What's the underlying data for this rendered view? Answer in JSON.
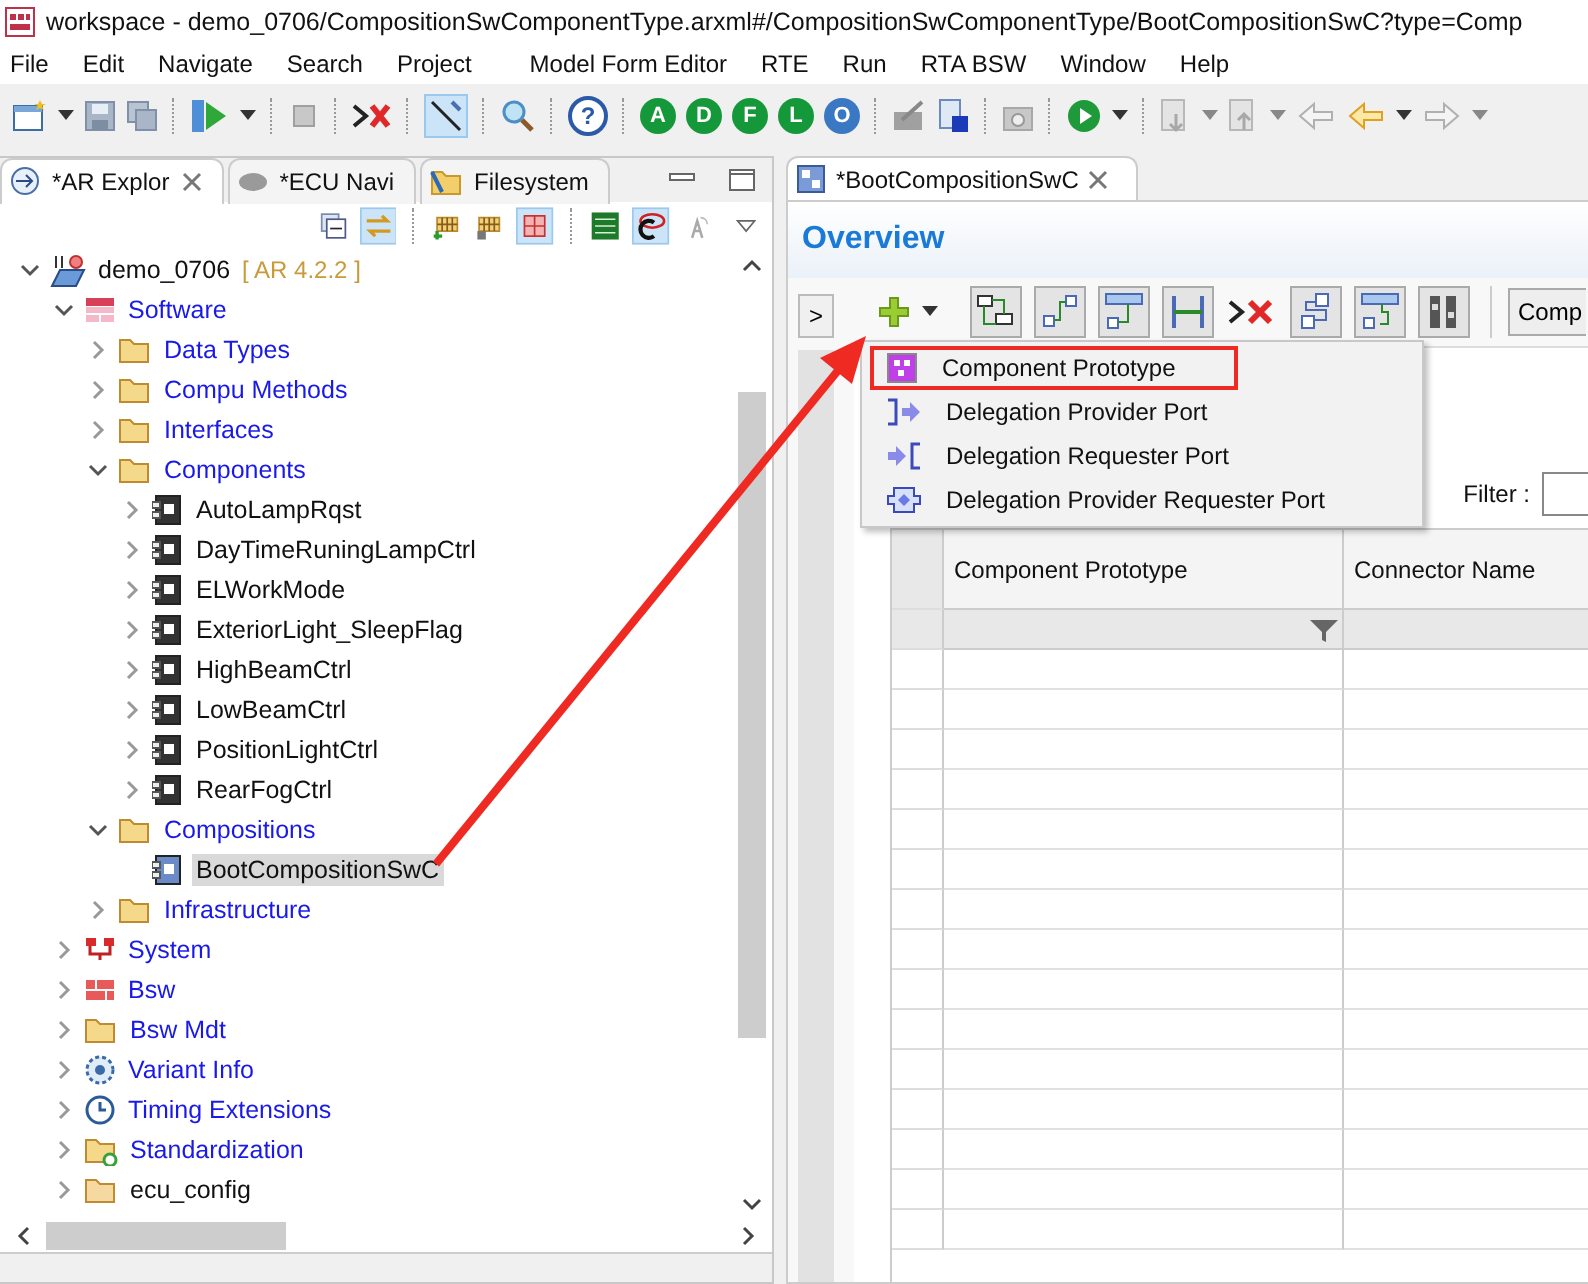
{
  "window": {
    "title": "workspace - demo_0706/CompositionSwComponentType.arxml#/CompositionSwComponentType/BootCompositionSwC?type=Comp"
  },
  "menu": [
    "File",
    "Edit",
    "Navigate",
    "Search",
    "Project",
    "Model Form Editor",
    "RTE",
    "Run",
    "RTA BSW",
    "Window",
    "Help"
  ],
  "toolbar": {
    "help": "?",
    "letter_buttons": [
      {
        "label": "A",
        "color": "#15983a"
      },
      {
        "label": "D",
        "color": "#15983a"
      },
      {
        "label": "F",
        "color": "#15983a"
      },
      {
        "label": "L",
        "color": "#15983a"
      },
      {
        "label": "O",
        "color": "#3b78c4"
      }
    ]
  },
  "left_panel": {
    "tabs": [
      {
        "label": "*AR Explor",
        "selected": true
      },
      {
        "label": "*ECU Navi",
        "selected": false
      },
      {
        "label": "Filesystem",
        "selected": false
      }
    ],
    "tree": [
      {
        "label": "demo_0706",
        "badge": "[ AR 4.2.2 ]",
        "kind": "project",
        "expanded": true,
        "selected": false,
        "children": [
          {
            "label": "Software",
            "kind": "software",
            "expanded": true,
            "selected": false,
            "children": [
              {
                "label": "Data Types",
                "kind": "folder",
                "expanded": false,
                "selected": false
              },
              {
                "label": "Compu Methods",
                "kind": "folder",
                "expanded": false,
                "selected": false
              },
              {
                "label": "Interfaces",
                "kind": "folder",
                "expanded": false,
                "selected": false
              },
              {
                "label": "Components",
                "kind": "folder",
                "expanded": true,
                "selected": false,
                "children": [
                  {
                    "label": "AutoLampRqst",
                    "kind": "component",
                    "expanded": false,
                    "selected": false
                  },
                  {
                    "label": "DayTimeRuningLampCtrl",
                    "kind": "component",
                    "expanded": false,
                    "selected": false
                  },
                  {
                    "label": "ELWorkMode",
                    "kind": "component",
                    "expanded": false,
                    "selected": false
                  },
                  {
                    "label": "ExteriorLight_SleepFlag",
                    "kind": "component",
                    "expanded": false,
                    "selected": false
                  },
                  {
                    "label": "HighBeamCtrl",
                    "kind": "component",
                    "expanded": false,
                    "selected": false
                  },
                  {
                    "label": "LowBeamCtrl",
                    "kind": "component",
                    "expanded": false,
                    "selected": false
                  },
                  {
                    "label": "PositionLightCtrl",
                    "kind": "component",
                    "expanded": false,
                    "selected": false
                  },
                  {
                    "label": "RearFogCtrl",
                    "kind": "component",
                    "expanded": false,
                    "selected": false
                  }
                ]
              },
              {
                "label": "Compositions",
                "kind": "folder",
                "expanded": true,
                "selected": false,
                "children": [
                  {
                    "label": "BootCompositionSwC",
                    "kind": "composition",
                    "selected": true
                  }
                ]
              },
              {
                "label": "Infrastructure",
                "kind": "folder",
                "expanded": false,
                "selected": false
              }
            ]
          },
          {
            "label": "System",
            "kind": "system",
            "expanded": false,
            "selected": false
          },
          {
            "label": "Bsw",
            "kind": "bsw",
            "expanded": false,
            "selected": false
          },
          {
            "label": "Bsw Mdt",
            "kind": "folder",
            "expanded": false,
            "selected": false
          },
          {
            "label": "Variant Info",
            "kind": "variant",
            "expanded": false,
            "selected": false
          },
          {
            "label": "Timing Extensions",
            "kind": "timing",
            "expanded": false,
            "selected": false
          },
          {
            "label": "Standardization",
            "kind": "std-folder",
            "expanded": false,
            "selected": false
          },
          {
            "label": "ecu_config",
            "kind": "plain-folder",
            "expanded": false,
            "selected": false
          }
        ]
      }
    ]
  },
  "editor": {
    "tab": "*BootCompositionSwC",
    "heading": "Overview",
    "side_toggle": ">",
    "comp_button": "Comp",
    "filter_label": "Filter :",
    "add_menu": [
      {
        "label": "Component Prototype",
        "kind": "prototype",
        "highlighted": true
      },
      {
        "label": "Delegation Provider Port",
        "kind": "provider",
        "highlighted": false
      },
      {
        "label": "Delegation Requester Port",
        "kind": "requester",
        "highlighted": false
      },
      {
        "label": "Delegation Provider Requester Port",
        "kind": "provider-requester",
        "highlighted": false
      }
    ],
    "table": {
      "columns": [
        "Component Prototype",
        "Connector Name"
      ]
    }
  }
}
